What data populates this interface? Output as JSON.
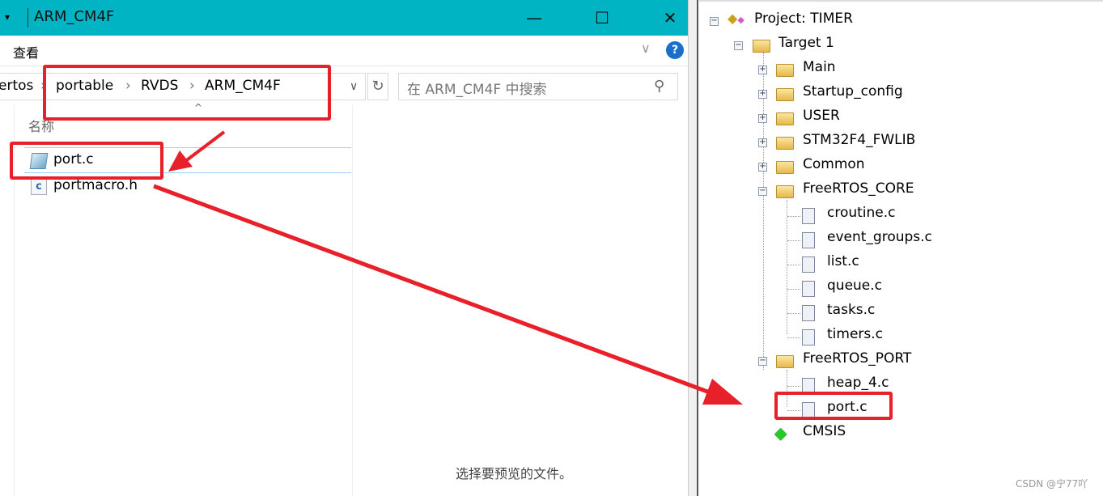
{
  "explorer": {
    "title": "ARM_CM4F",
    "ribbon_tab": "查看",
    "help_label": "?",
    "breadcrumb": [
      "ertos",
      "portable",
      "RVDS",
      "ARM_CM4F"
    ],
    "search_placeholder": "在 ARM_CM4F 中搜索",
    "column_header": "名称",
    "files": [
      {
        "name": "port.c",
        "icon": "c-source-file-icon",
        "selected": true
      },
      {
        "name": "portmacro.h",
        "icon": "c-header-file-icon",
        "selected": false
      }
    ],
    "preview_text": "选择要预览的文件。",
    "accent_color": "#00b4c4"
  },
  "project_tree": {
    "project": "Project: TIMER",
    "target": "Target 1",
    "groups": [
      {
        "name": "Main",
        "expanded": false,
        "files": []
      },
      {
        "name": "Startup_config",
        "expanded": false,
        "files": []
      },
      {
        "name": "USER",
        "expanded": false,
        "files": []
      },
      {
        "name": "STM32F4_FWLIB",
        "expanded": false,
        "files": []
      },
      {
        "name": "Common",
        "expanded": false,
        "files": []
      },
      {
        "name": "FreeRTOS_CORE",
        "expanded": true,
        "files": [
          "croutine.c",
          "event_groups.c",
          "list.c",
          "queue.c",
          "tasks.c",
          "timers.c"
        ]
      },
      {
        "name": "FreeRTOS_PORT",
        "expanded": true,
        "files": [
          "heap_4.c",
          "port.c"
        ]
      }
    ],
    "cmsis": "CMSIS"
  },
  "annotation_color": "#e8202a",
  "watermark": "CSDN @宁77吖"
}
